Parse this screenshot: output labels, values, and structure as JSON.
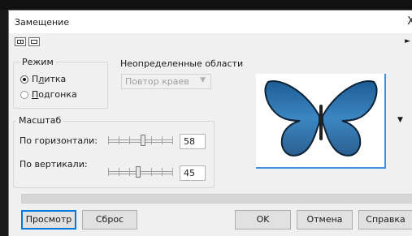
{
  "dialog": {
    "title": "Замещение",
    "close_glyph": "X"
  },
  "toolbar": {
    "btn1_icon": "split-view-icon",
    "btn2_icon": "single-view-icon",
    "right_arrow": "►"
  },
  "mode_group": {
    "legend": "Режим",
    "tile_pre": "П",
    "tile_ul": "л",
    "tile_post": "итка",
    "fit_ul": "П",
    "fit_post": "одгонка",
    "selected": "Плитка"
  },
  "undefined_areas": {
    "label": "Неопределенные области",
    "value": "Повтор краев"
  },
  "scale_group": {
    "legend": "Масштаб",
    "horizontal_label": "По горизонтали:",
    "vertical_label": "По вертикали:",
    "horizontal_value": "58",
    "vertical_value": "45"
  },
  "preview": {
    "image": "blue-butterfly",
    "dropdown_arrow": "▼"
  },
  "buttons": {
    "preview": "Просмотр",
    "reset": "Сброс",
    "ok": "OK",
    "cancel": "Отмена",
    "help": "Справка"
  },
  "colors": {
    "accent": "#0078d7",
    "butterfly": "#2f6fa8"
  }
}
